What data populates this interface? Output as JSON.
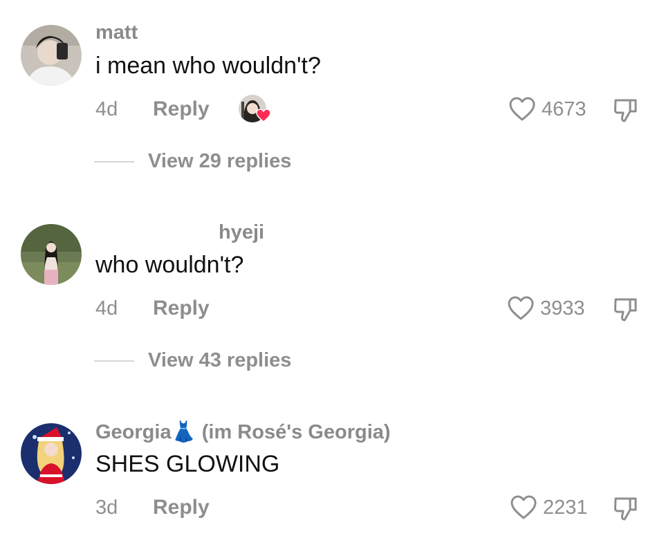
{
  "comments": [
    {
      "username": "matt",
      "text": "i mean who wouldn't?",
      "age": "4d",
      "reply_label": "Reply",
      "likes": "4673",
      "view_replies": "View 29 replies",
      "liked_by_creator": true
    },
    {
      "username": "hyeji",
      "text": "who wouldn't?",
      "age": "4d",
      "reply_label": "Reply",
      "likes": "3933",
      "view_replies": "View 43 replies",
      "liked_by_creator": false
    },
    {
      "username": "Georgia👗 (im Rosé's Georgia)",
      "text": "SHES GLOWING",
      "age": "3d",
      "reply_label": "Reply",
      "likes": "2231",
      "liked_by_creator": false
    }
  ],
  "colors": {
    "secondary_text": "#8e8e8e",
    "primary_text": "#111111",
    "heart_red": "#fe2c55"
  },
  "icons": {
    "like": "heart-outline-icon",
    "dislike": "thumbs-down-icon",
    "creator_liked": "heart-filled-icon"
  }
}
